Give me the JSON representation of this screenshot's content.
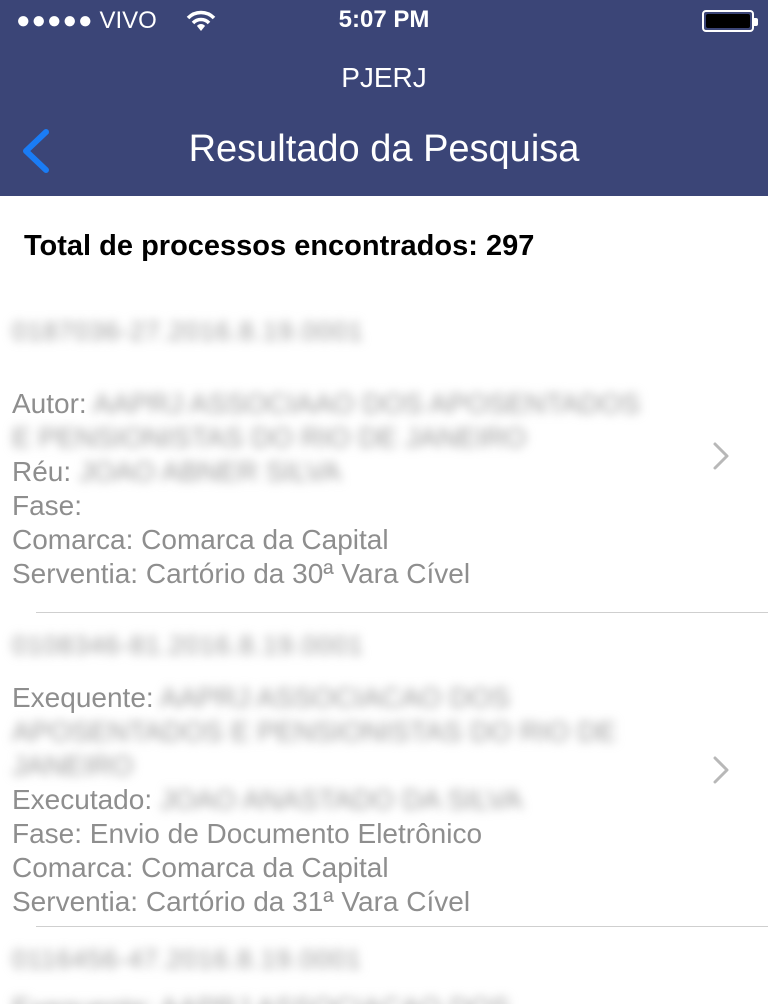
{
  "status_bar": {
    "signal": "●●●●●",
    "carrier": "VIVO",
    "time": "5:07 PM"
  },
  "app_title": "PJERJ",
  "nav": {
    "title": "Resultado da Pesquisa"
  },
  "total_label": "Total de processos encontrados: 297",
  "results": [
    {
      "numero": "0187036-27.2016.8.19.0001",
      "autor_label": "Autor:",
      "autor_value_1": "AAPRJ ASSOCIAAO DOS APOSENTADOS",
      "autor_value_2": "E PENSIONISTAS DO RIO DE JANEIRO",
      "reu_label": "Réu:",
      "reu_value": "JOAO ABNER SILVA",
      "fase": "Fase:",
      "comarca": "Comarca: Comarca da Capital",
      "serventia": "Serventia: Cartório da 30ª Vara Cível"
    },
    {
      "numero": "0108346-81.2016.8.19.0001",
      "exequente_label": "Exequente:",
      "exequente_value_1": "AAPRJ ASSOCIACAO DOS",
      "exequente_value_2": "APOSENTADOS E PENSIONISTAS DO RIO DE",
      "exequente_value_3": "JANEIRO",
      "executado_label": "Executado:",
      "executado_value": "JOAO ANASTADO DA SILVA",
      "fase": "Fase: Envio de Documento Eletrônico",
      "comarca": "Comarca: Comarca da Capital",
      "serventia": "Serventia: Cartório da 31ª Vara Cível"
    },
    {
      "numero": "0116456-47.2016.8.19.0001",
      "partial_line": "Exequente: AAPRJ ASSOCIACAO DOS"
    }
  ]
}
